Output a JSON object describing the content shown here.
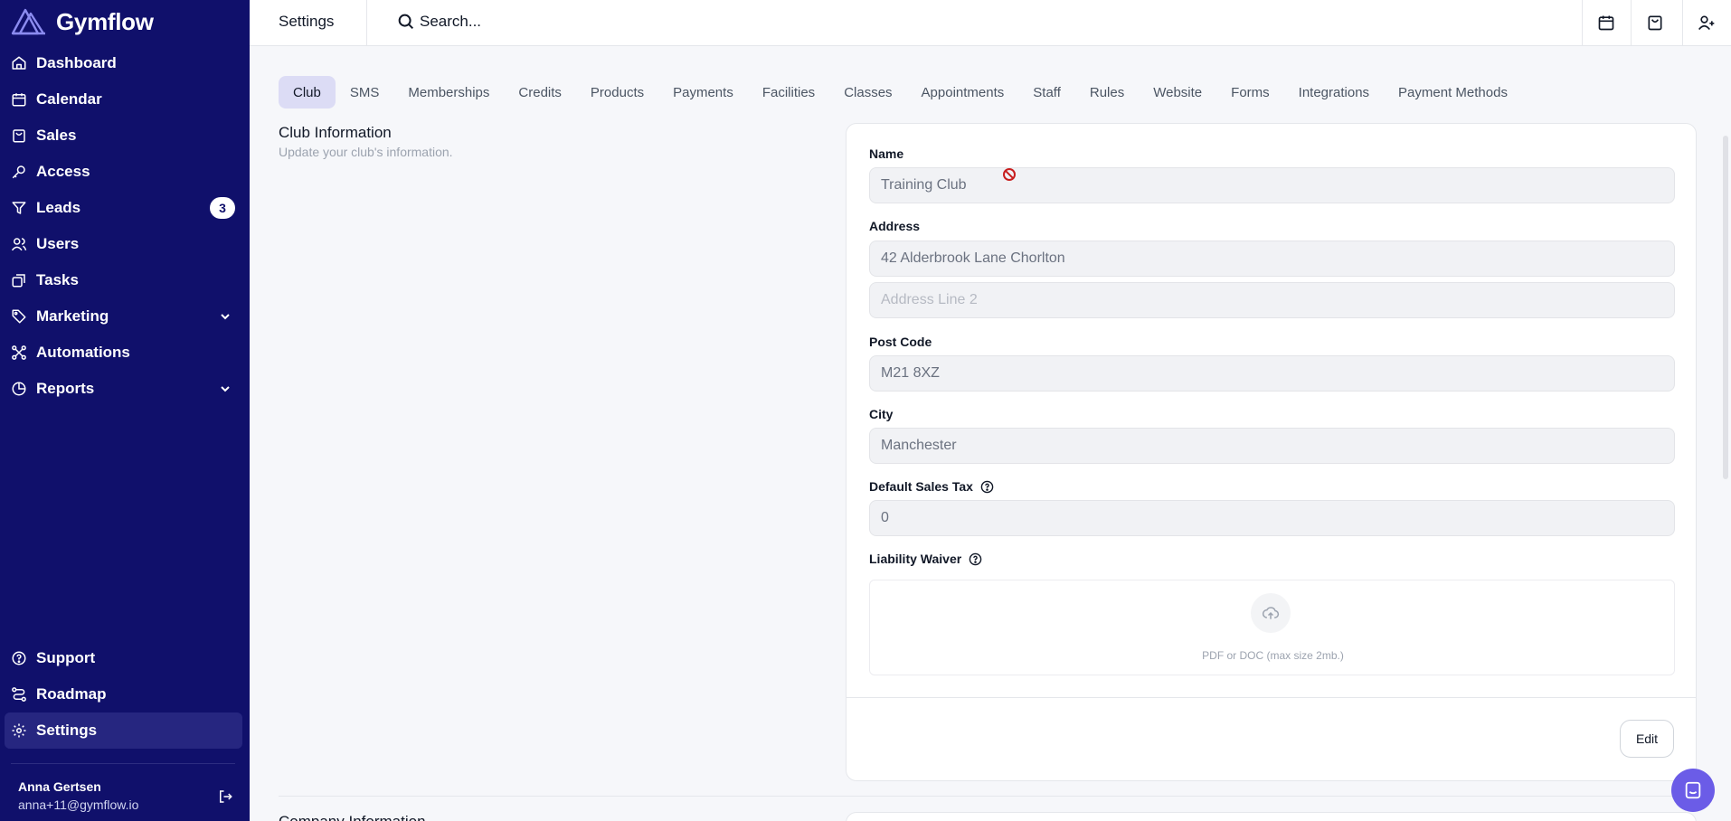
{
  "app": {
    "name": "Gymflow"
  },
  "sidebar": {
    "items": [
      {
        "label": "Dashboard",
        "icon": "home-icon"
      },
      {
        "label": "Calendar",
        "icon": "calendar-icon"
      },
      {
        "label": "Sales",
        "icon": "shopping-bag-icon"
      },
      {
        "label": "Access",
        "icon": "key-icon"
      },
      {
        "label": "Leads",
        "icon": "funnel-icon",
        "badge": "3"
      },
      {
        "label": "Users",
        "icon": "users-icon"
      },
      {
        "label": "Tasks",
        "icon": "tasks-icon"
      },
      {
        "label": "Marketing",
        "icon": "tag-icon",
        "expandable": true
      },
      {
        "label": "Automations",
        "icon": "automation-icon"
      },
      {
        "label": "Reports",
        "icon": "pie-chart-icon",
        "expandable": true
      }
    ],
    "bottom_items": [
      {
        "label": "Support",
        "icon": "help-circle-icon"
      },
      {
        "label": "Roadmap",
        "icon": "route-icon"
      },
      {
        "label": "Settings",
        "icon": "gear-icon",
        "active": true
      }
    ],
    "user": {
      "name": "Anna Gertsen",
      "email": "anna+11@gymflow.io"
    }
  },
  "topbar": {
    "title": "Settings",
    "search_placeholder": "Search...",
    "actions": [
      "calendar-icon",
      "shopping-bag-icon",
      "add-user-icon"
    ]
  },
  "tabs": [
    "Club",
    "SMS",
    "Memberships",
    "Credits",
    "Products",
    "Payments",
    "Facilities",
    "Classes",
    "Appointments",
    "Staff",
    "Rules",
    "Website",
    "Forms",
    "Integrations",
    "Payment Methods"
  ],
  "active_tab": "Club",
  "section": {
    "title": "Club Information",
    "subtitle": "Update your club's information."
  },
  "form": {
    "name_label": "Name",
    "name_value": "Training Club",
    "address_label": "Address",
    "address1_value": "42 Alderbrook Lane Chorlton",
    "address2_placeholder": "Address Line 2",
    "postcode_label": "Post Code",
    "postcode_value": "M21 8XZ",
    "city_label": "City",
    "city_value": "Manchester",
    "tax_label": "Default Sales Tax",
    "tax_value": "0",
    "waiver_label": "Liability Waiver",
    "upload_hint": "PDF or DOC (max size 2mb.)",
    "edit_label": "Edit"
  },
  "next_section": {
    "title": "Company Information"
  },
  "colors": {
    "sidebar_bg": "#10106b",
    "active_tab_bg": "#dcdcf5",
    "chat_button": "#6b5ce7"
  }
}
